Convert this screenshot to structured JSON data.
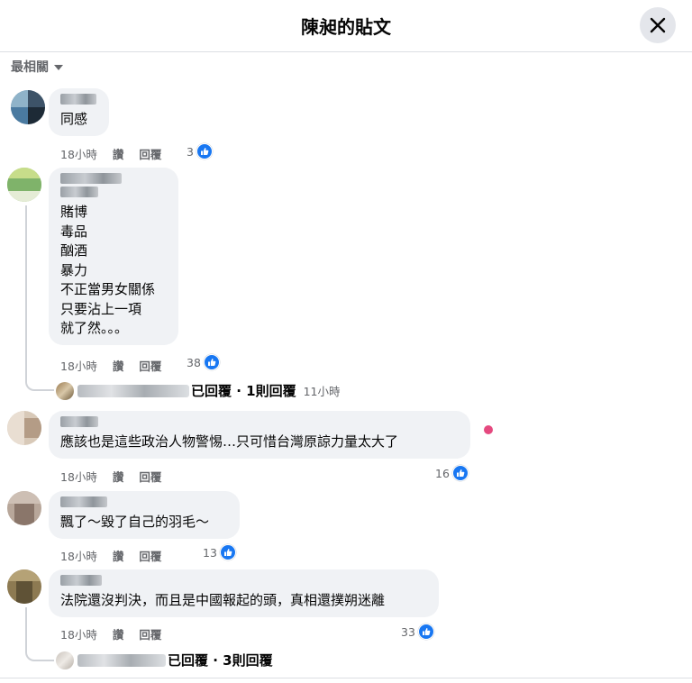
{
  "dialog": {
    "title": "陳昶的貼文"
  },
  "sort": {
    "label": "最相關"
  },
  "comments": [
    {
      "text": "同感",
      "time": "18小時",
      "like": "讚",
      "reply": "回覆",
      "reactions": "3"
    },
    {
      "text": "賭博\n毒品\n酗酒\n暴力\n不正當男女關係\n只要沾上一項\n就了然。。。",
      "time": "18小時",
      "like": "讚",
      "reply": "回覆",
      "reactions": "38",
      "replies_summary": {
        "text": "已回覆 · 1則回覆",
        "time": "11小時"
      }
    },
    {
      "text": "應該也是這些政治人物警惕…只可惜台灣原諒力量太大了",
      "time": "18小時",
      "like": "讚",
      "reply": "回覆",
      "reactions": "16"
    },
    {
      "text": "飄了～毀了自己的羽毛～",
      "time": "18小時",
      "like": "讚",
      "reply": "回覆",
      "reactions": "13"
    },
    {
      "text": "法院還沒判決，而且是中國報起的頭，真相還撲朔迷離",
      "time": "18小時",
      "like": "讚",
      "reply": "回覆",
      "reactions": "33",
      "replies_summary": {
        "text": "已回覆 · 3則回覆"
      }
    }
  ],
  "colors": {
    "like_blue": "#1877f2",
    "bubble_bg": "#f0f2f5",
    "meta_gray": "#65676b",
    "online_pink": "#e5497f"
  }
}
